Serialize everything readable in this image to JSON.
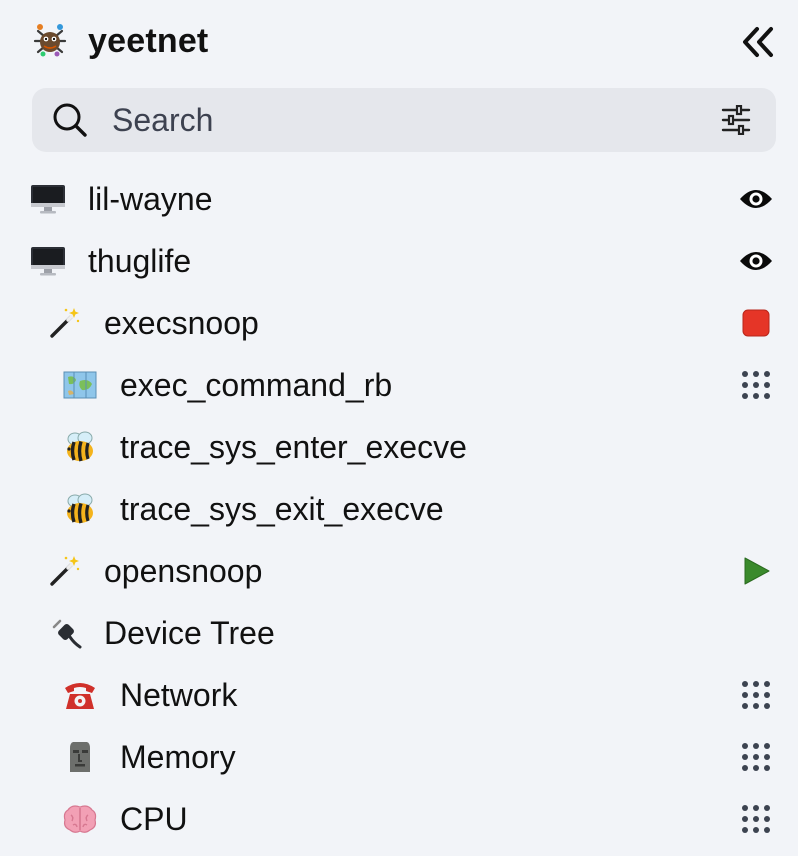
{
  "header": {
    "title": "yeetnet",
    "logo_icon": "spider-bug-logo",
    "collapse_icon": "double-chevron-left-icon"
  },
  "search": {
    "placeholder": "Search",
    "filter_icon": "sliders-icon"
  },
  "tree": [
    {
      "label": "lil-wayne",
      "icon": "computer-icon",
      "level": 0,
      "action": "eye-icon"
    },
    {
      "label": "thuglife",
      "icon": "computer-icon",
      "level": 0,
      "action": "eye-icon"
    },
    {
      "label": "execsnoop",
      "icon": "magic-wand-icon",
      "level": 1,
      "action": "stop-icon"
    },
    {
      "label": "exec_command_rb",
      "icon": "map-icon",
      "level": 2,
      "action": "drag-handle-icon"
    },
    {
      "label": "trace_sys_enter_execve",
      "icon": "bee-icon",
      "level": 2,
      "action": null
    },
    {
      "label": "trace_sys_exit_execve",
      "icon": "bee-icon",
      "level": 2,
      "action": null
    },
    {
      "label": "opensnoop",
      "icon": "magic-wand-icon",
      "level": 1,
      "action": "play-icon"
    },
    {
      "label": "Device Tree",
      "icon": "plug-icon",
      "level": 1,
      "action": null
    },
    {
      "label": "Network",
      "icon": "telephone-icon",
      "level": 2,
      "action": "drag-handle-icon"
    },
    {
      "label": "Memory",
      "icon": "moai-icon",
      "level": 2,
      "action": "drag-handle-icon"
    },
    {
      "label": "CPU",
      "icon": "brain-icon",
      "level": 2,
      "action": "drag-handle-icon"
    }
  ],
  "colors": {
    "background": "#f2f4f8",
    "search_bg": "#e5e7ec",
    "stop": "#e53527",
    "play": "#3a8a2c",
    "drag_handle": "#3c4350"
  }
}
